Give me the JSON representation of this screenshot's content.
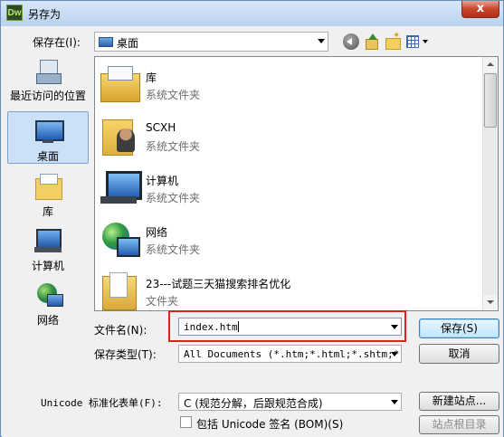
{
  "window": {
    "title": "另存为",
    "app_badge": "Dw",
    "close_glyph": "x"
  },
  "save_in": {
    "label": "保存在(I):",
    "value": "桌面"
  },
  "places": [
    {
      "label": "最近访问的位置",
      "icon": "recent-places-icon"
    },
    {
      "label": "桌面",
      "icon": "desktop-icon",
      "selected": true
    },
    {
      "label": "库",
      "icon": "library-icon"
    },
    {
      "label": "计算机",
      "icon": "computer-icon"
    },
    {
      "label": "网络",
      "icon": "network-icon"
    }
  ],
  "files": [
    {
      "name": "库",
      "type": "系统文件夹",
      "icon": "library-folder-icon"
    },
    {
      "name": "SCXH",
      "type": "系统文件夹",
      "icon": "user-folder-icon"
    },
    {
      "name": "计算机",
      "type": "系统文件夹",
      "icon": "computer-icon"
    },
    {
      "name": "网络",
      "type": "系统文件夹",
      "icon": "network-icon"
    },
    {
      "name": "23---试题三天猫搜索排名优化",
      "type": "文件夹",
      "icon": "folder-icon"
    }
  ],
  "form": {
    "filename_label": "文件名(N):",
    "filename_value": "index.htm",
    "filetype_label": "保存类型(T):",
    "filetype_value": "All Documents (*.htm;*.html;*.shtm;*.",
    "unicode_label": "Unicode 标准化表单(F):",
    "unicode_value": "C (规范分解，后跟规范合成)",
    "bom_label": "包括 Unicode 签名 (BOM)(S)",
    "bom_checked": false
  },
  "buttons": {
    "save": "保存(S)",
    "cancel": "取消",
    "new_site": "新建站点...",
    "site_root": "站点根目录"
  },
  "colors": {
    "highlight": "#e0201c",
    "accent": "#3c7fb1"
  }
}
